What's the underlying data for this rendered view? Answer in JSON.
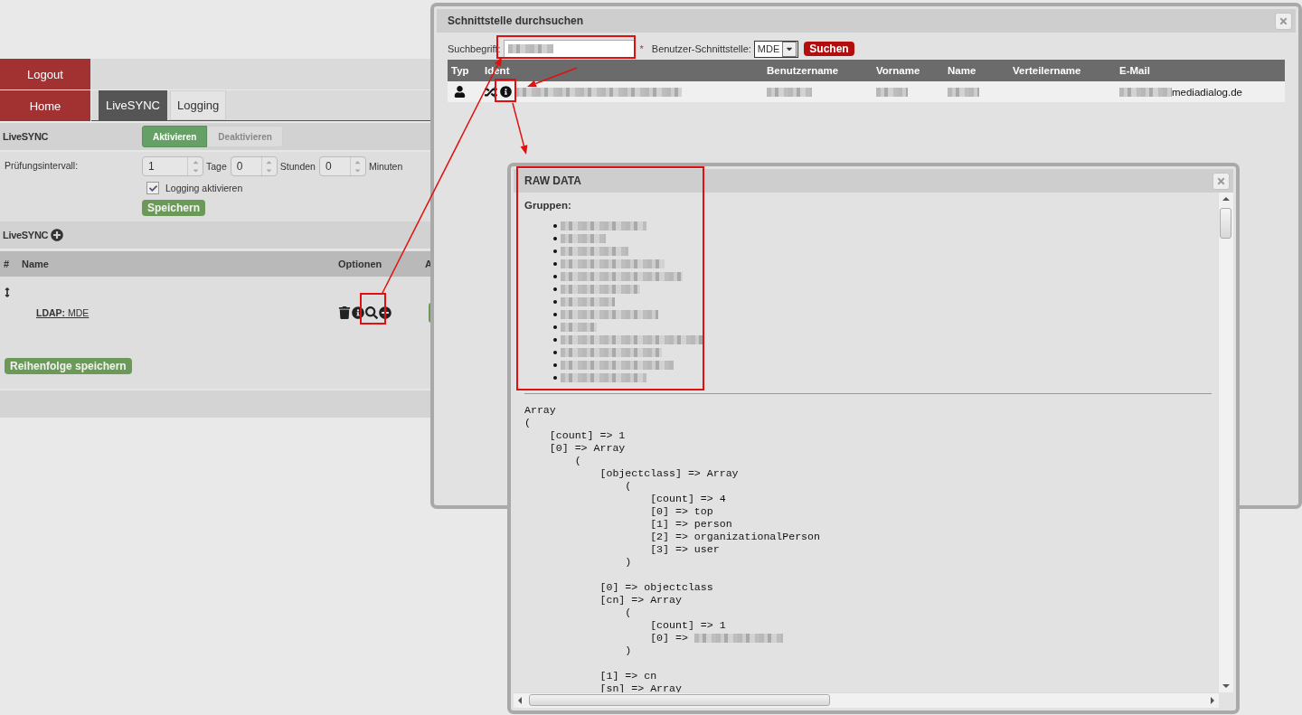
{
  "app": {
    "nav": [
      {
        "label": "Logout"
      },
      {
        "label": "Home"
      }
    ],
    "tabs": [
      {
        "label": "LiveSYNC",
        "selected": true
      },
      {
        "label": "Logging",
        "selected": false
      }
    ],
    "livesync_section": {
      "title": "LiveSYNC",
      "toggle": [
        {
          "label": "Aktivieren",
          "selected": true
        },
        {
          "label": "Deaktivieren",
          "selected": false
        }
      ]
    },
    "interval": {
      "label": "Prüfungsintervall:",
      "fields": [
        {
          "value": "1",
          "unit": "Tage"
        },
        {
          "value": "0",
          "unit": "Stunden"
        },
        {
          "value": "0",
          "unit": "Minuten"
        }
      ]
    },
    "logging_checkbox": {
      "label": "Logging aktivieren",
      "checked": true
    },
    "save_button": "Speichern",
    "list_section": {
      "title": "LiveSYNC"
    },
    "table": {
      "columns": [
        "#",
        "Name",
        "Optionen",
        "A"
      ],
      "rows": [
        {
          "name": "**LDAP:** MDE"
        }
      ]
    },
    "order_button": "Reihenfolge speichern"
  },
  "search_dialog": {
    "title": "Schnittstelle durchsuchen",
    "search": {
      "label": "Suchbegriff:",
      "redacted": true,
      "required_mark": "*"
    },
    "interface": {
      "label": "Benutzer-Schnittstelle:",
      "value": "MDE"
    },
    "search_button": "Suchen",
    "columns": [
      "Typ",
      "Ident",
      "Benutzername",
      "Vorname",
      "Name",
      "Verteilername",
      "E-Mail"
    ],
    "rows": [
      {
        "cells": [
          {
            "kind": "user-icon"
          },
          {
            "kind": "ident",
            "redacted": true
          },
          {
            "kind": "text",
            "redacted": true
          },
          {
            "kind": "text",
            "redacted": true
          },
          {
            "kind": "text",
            "redacted": true
          },
          {
            "kind": "empty"
          },
          {
            "kind": "text",
            "redacted": true,
            "text": "mediadialog.de"
          }
        ]
      }
    ]
  },
  "raw_data_dialog": {
    "title": "RAW DATA",
    "groups_label": "Gruppen:",
    "groups": [
      {
        "redacted": true
      },
      {
        "redacted": true
      },
      {
        "redacted": true
      },
      {
        "redacted": true
      },
      {
        "redacted": true
      },
      {
        "redacted": true
      },
      {
        "redacted": true
      },
      {
        "redacted": true
      },
      {
        "redacted": true
      },
      {
        "redacted": true
      },
      {
        "redacted": true
      },
      {
        "redacted": true
      },
      {
        "redacted": true
      }
    ],
    "code_lines": [
      {
        "kind": "text",
        "text": "Array"
      },
      {
        "kind": "text",
        "text": "("
      },
      {
        "kind": "text",
        "text": "    [count] => 1"
      },
      {
        "kind": "text",
        "text": "    [0] => Array"
      },
      {
        "kind": "text",
        "text": "        ("
      },
      {
        "kind": "text",
        "text": "            [objectclass] => Array"
      },
      {
        "kind": "text",
        "text": "                ("
      },
      {
        "kind": "text",
        "text": "                    [count] => 4"
      },
      {
        "kind": "text",
        "text": "                    [0] => top"
      },
      {
        "kind": "text",
        "text": "                    [1] => person"
      },
      {
        "kind": "text",
        "text": "                    [2] => organizationalPerson"
      },
      {
        "kind": "text",
        "text": "                    [3] => user"
      },
      {
        "kind": "text",
        "text": "                )"
      },
      {
        "kind": "blank"
      },
      {
        "kind": "text",
        "text": "            [0] => objectclass"
      },
      {
        "kind": "text",
        "text": "            [cn] => Array"
      },
      {
        "kind": "text",
        "text": "                ("
      },
      {
        "kind": "text",
        "text": "                    [count] => 1"
      },
      {
        "kind": "text",
        "text": "                    [0] => ",
        "redacted": true
      },
      {
        "kind": "text",
        "text": "                )"
      },
      {
        "kind": "blank"
      },
      {
        "kind": "text",
        "text": "            [1] => cn"
      },
      {
        "kind": "text",
        "text": "            [sn] => Array"
      }
    ]
  },
  "annotations": [
    {
      "kind": "box"
    },
    {
      "kind": "box"
    },
    {
      "kind": "box"
    },
    {
      "kind": "box"
    },
    {
      "kind": "arrow"
    },
    {
      "kind": "arrow"
    },
    {
      "kind": "arrow"
    }
  ]
}
